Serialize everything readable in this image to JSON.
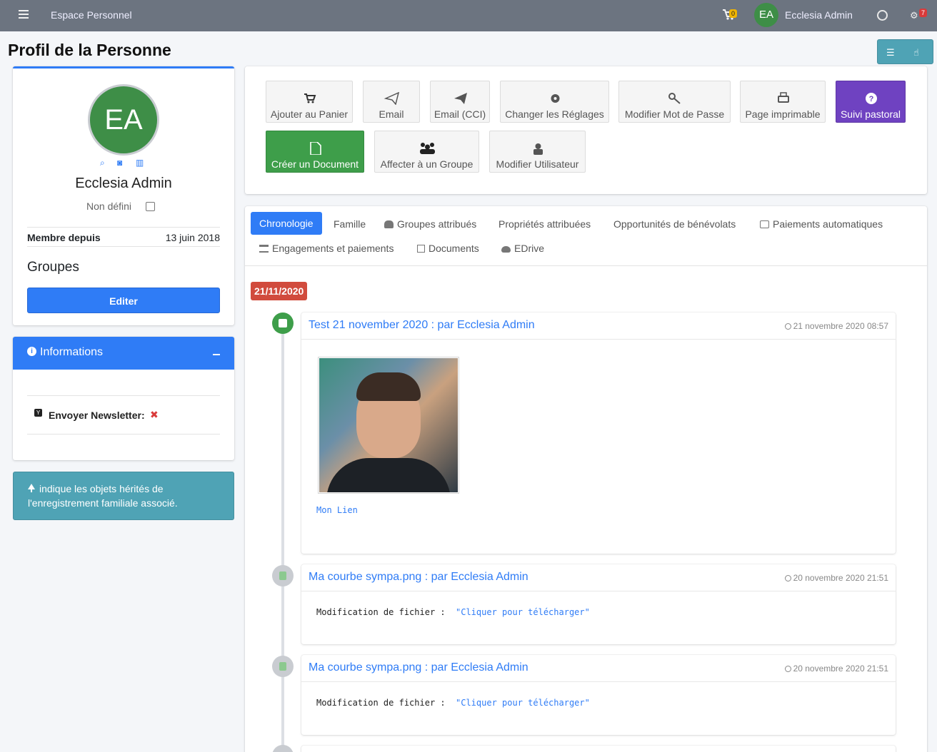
{
  "topbar": {
    "brand": "Espace Personnel",
    "cart_count": "0",
    "avatar_initials": "EA",
    "user_name": "Ecclesia Admin",
    "notif_count": "7"
  },
  "page": {
    "title": "Profil de la Personne"
  },
  "profile": {
    "initials": "EA",
    "name": "Ecclesia Admin",
    "subtitle": "Non défini",
    "member_label": "Membre depuis",
    "member_value": "13 juin 2018",
    "groups_title": "Groupes",
    "edit_label": "Editer"
  },
  "info": {
    "title": "Informations",
    "newsletter_label": "Envoyer Newsletter:"
  },
  "callout": {
    "text": "indique les objets hérités de l'enregistrement familiale associé."
  },
  "actions": {
    "add_cart": "Ajouter au Panier",
    "email": "Email",
    "email_cci": "Email (CCI)",
    "settings": "Changer les Réglages",
    "password": "Modifier Mot de Passe",
    "print": "Page imprimable",
    "pastoral": "Suivi pastoral",
    "create_doc": "Créer un Document",
    "assign_group": "Affecter à un Groupe",
    "edit_user": "Modifier Utilisateur"
  },
  "tabs": [
    "Chronologie",
    "Famille",
    "Groupes attribués",
    "Propriétés attribuées",
    "Opportunités de bénévolats",
    "Paiements automatiques",
    "Engagements et paiements",
    "Documents",
    "EDrive"
  ],
  "timeline": {
    "date_badge": "21/11/2020",
    "items": [
      {
        "title": "Test 21 november 2020 : par Ecclesia Admin",
        "time": "21 novembre 2020 08:57",
        "link": "Mon Lien"
      },
      {
        "title": "Ma courbe sympa.png : par Ecclesia Admin",
        "time": "20 novembre 2020 21:51",
        "text": "Modification de fichier :",
        "link": "\"Cliquer pour télécharger\""
      },
      {
        "title": "Ma courbe sympa.png : par Ecclesia Admin",
        "time": "20 novembre 2020 21:51",
        "text": "Modification de fichier :",
        "link": "\"Cliquer pour télécharger\""
      }
    ]
  },
  "colors": {
    "primary": "#2f7cf6",
    "success": "#3e9e4a",
    "purple": "#6f42c1",
    "danger": "#d14b3d",
    "info": "#4fa3b5",
    "topbar": "#6c7480"
  }
}
